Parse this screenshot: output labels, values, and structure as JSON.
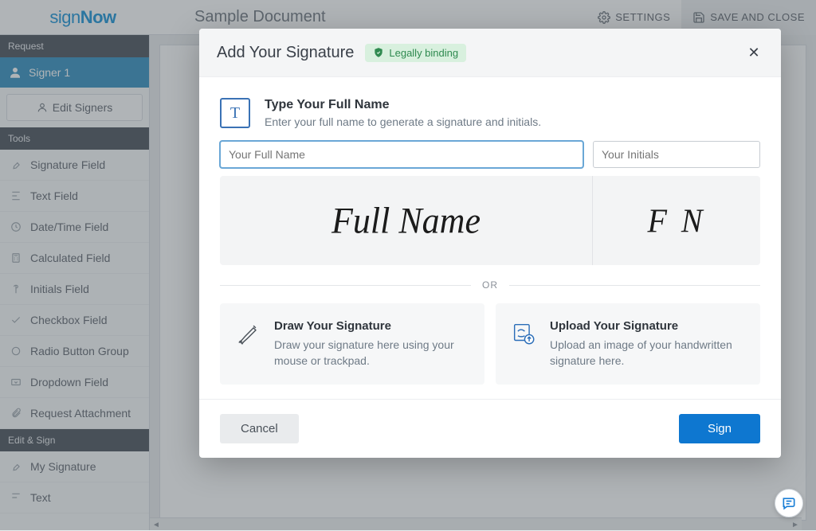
{
  "app": {
    "logo_part1": "sign",
    "logo_part2": "Now"
  },
  "header": {
    "document_title": "Sample Document",
    "settings_label": "SETTINGS",
    "save_close_label": "SAVE AND CLOSE"
  },
  "sidebar": {
    "request_header": "Request",
    "signer_label": "Signer 1",
    "edit_signers_label": "Edit Signers",
    "tools_header": "Tools",
    "tools": [
      {
        "label": "Signature Field"
      },
      {
        "label": "Text Field"
      },
      {
        "label": "Date/Time Field"
      },
      {
        "label": "Calculated Field"
      },
      {
        "label": "Initials Field"
      },
      {
        "label": "Checkbox Field"
      },
      {
        "label": "Radio Button Group"
      },
      {
        "label": "Dropdown Field"
      },
      {
        "label": "Request Attachment"
      }
    ],
    "edit_sign_header": "Edit & Sign",
    "edit_sign_items": [
      {
        "label": "My Signature"
      },
      {
        "label": "Text"
      }
    ]
  },
  "modal": {
    "title": "Add Your Signature",
    "badge_label": "Legally binding",
    "type_section": {
      "title": "Type Your Full Name",
      "subtitle": "Enter your full name to generate a signature and initials.",
      "name_placeholder": "Your Full Name",
      "initials_placeholder": "Your Initials",
      "preview_name": "Full Name",
      "preview_initials": "F N"
    },
    "or_label": "OR",
    "draw_card": {
      "title": "Draw Your Signature",
      "subtitle": "Draw your signature here using your mouse or trackpad."
    },
    "upload_card": {
      "title": "Upload Your Signature",
      "subtitle": "Upload an image of your handwritten signature here."
    },
    "cancel_label": "Cancel",
    "sign_label": "Sign"
  }
}
